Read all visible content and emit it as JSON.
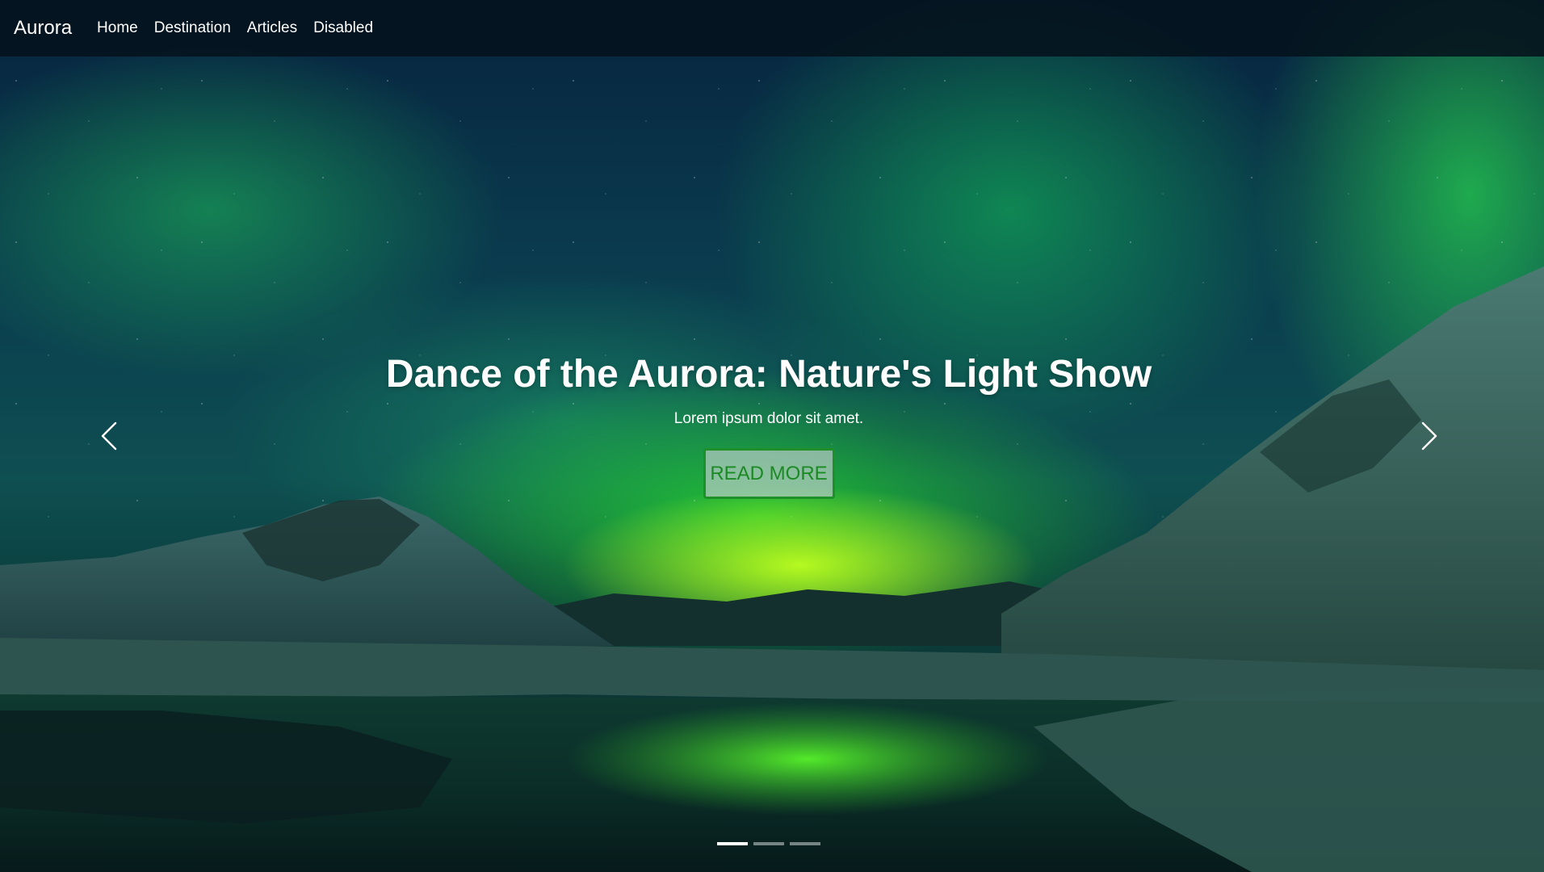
{
  "navbar": {
    "brand": "Aurora",
    "links": [
      {
        "label": "Home"
      },
      {
        "label": "Destination"
      },
      {
        "label": "Articles"
      },
      {
        "label": "Disabled"
      }
    ]
  },
  "carousel": {
    "caption": {
      "title": "Dance of the Aurora: Nature's Light Show",
      "text": "Lorem ipsum dolor sit amet.",
      "button_label": "READ MORE"
    },
    "prev_icon": "chevron-left-icon",
    "next_icon": "chevron-right-icon",
    "slide_count": 3,
    "active_slide": 1
  },
  "colors": {
    "accent": "#1f8f2a",
    "button_text": "#1b8a24",
    "navbar_bg": "#04121c"
  }
}
